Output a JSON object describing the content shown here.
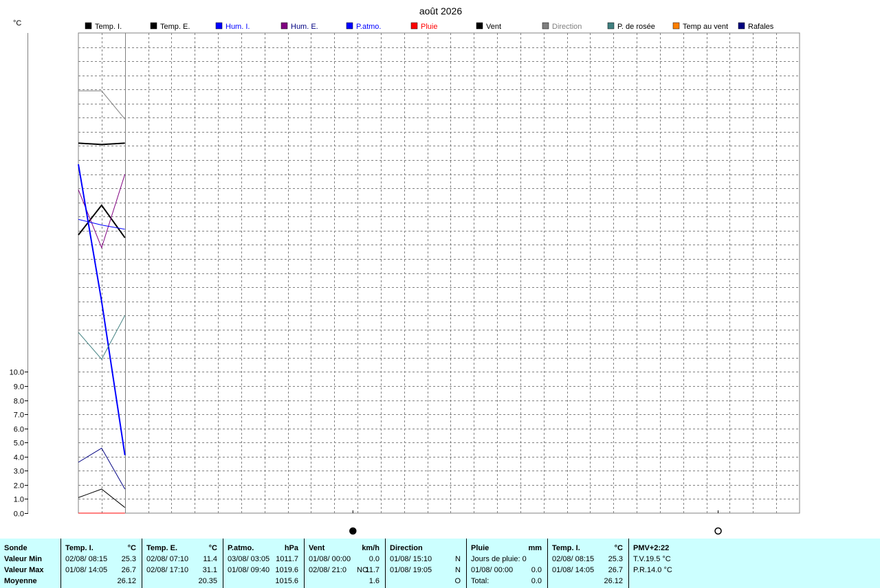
{
  "title": "août 2026",
  "y_unit": "°C",
  "colors": {
    "temp_i": "#000000",
    "temp_e": "#000000",
    "hum_i": "#0000ff",
    "hum_e": "#800080",
    "patmo": "#0000ff",
    "pluie": "#ff0000",
    "vent": "#000000",
    "direction": "#808080",
    "rosee": "#408080",
    "temp_vent": "#ff8000",
    "rafales": "#000080",
    "panel_bg": "#ccffff",
    "grid": "#808080"
  },
  "legend": [
    {
      "label": "Temp. I.",
      "color": "#000000",
      "text_color": "#000000"
    },
    {
      "label": "Temp. E.",
      "color": "#000000",
      "text_color": "#000000"
    },
    {
      "label": "Hum. I.",
      "color": "#0000ff",
      "text_color": "#0000ff"
    },
    {
      "label": "Hum. E.",
      "color": "#800080",
      "text_color": "#000080"
    },
    {
      "label": "P.atmo.",
      "color": "#0000ff",
      "text_color": "#0000ff"
    },
    {
      "label": "Pluie",
      "color": "#ff0000",
      "text_color": "#ff0000"
    },
    {
      "label": "Vent",
      "color": "#000000",
      "text_color": "#000000"
    },
    {
      "label": "Direction",
      "color": "#808080",
      "text_color": "#808080"
    },
    {
      "label": "P. de rosée",
      "color": "#408080",
      "text_color": "#000000"
    },
    {
      "label": "Temp au vent",
      "color": "#ff8000",
      "text_color": "#000000"
    },
    {
      "label": "Rafales",
      "color": "#000080",
      "text_color": "#000000"
    }
  ],
  "chart_data": {
    "type": "line",
    "title": "août 2026",
    "ylabel": "°C",
    "ylim": [
      0,
      34
    ],
    "yticks": [
      "0.0",
      "1.0",
      "2.0",
      "3.0",
      "4.0",
      "5.0",
      "6.0",
      "7.0",
      "8.0",
      "9.0",
      "10.0"
    ],
    "x_days": 31,
    "x_markers": [
      {
        "day": 12.8,
        "symbol": "full-moon-icon"
      },
      {
        "day": 28.5,
        "symbol": "new-moon-icon"
      }
    ],
    "x": [
      1,
      2,
      3
    ],
    "grid": true,
    "series": [
      {
        "name": "Temp. I.",
        "color": "#000000",
        "width": 2,
        "values": [
          26.2,
          26.1,
          26.2
        ]
      },
      {
        "name": "Temp. E.",
        "color": "#000000",
        "width": 2,
        "values": [
          19.7,
          21.8,
          19.5
        ]
      },
      {
        "name": "Hum. E.",
        "color": "#800080",
        "width": 1,
        "values": [
          22.9,
          18.8,
          24.0
        ]
      },
      {
        "name": "P.atmo.",
        "color": "#0000ff",
        "width": 2,
        "values": [
          24.7,
          15.0,
          4.1
        ]
      },
      {
        "name": "Hum. I.",
        "color": "#0000ff",
        "width": 1,
        "values": [
          20.8,
          20.4,
          20.1
        ]
      },
      {
        "name": "Direction",
        "color": "#808080",
        "width": 1,
        "values": [
          29.9,
          29.9,
          27.9
        ]
      },
      {
        "name": "P. de rosée",
        "color": "#408080",
        "width": 1,
        "values": [
          12.8,
          10.9,
          14.0
        ]
      },
      {
        "name": "Rafales",
        "color": "#000080",
        "width": 1,
        "values": [
          3.6,
          4.6,
          1.7
        ]
      },
      {
        "name": "Vent",
        "color": "#000000",
        "width": 1,
        "values": [
          1.1,
          1.7,
          0.4
        ]
      },
      {
        "name": "Pluie",
        "color": "#ff0000",
        "width": 1,
        "values": [
          0.0,
          0.0,
          0.0
        ]
      }
    ]
  },
  "stats": {
    "sonde": {
      "title": "Sonde",
      "rows": [
        "Valeur Min",
        "Valeur Max",
        "Moyenne"
      ]
    },
    "temp_i": {
      "title": "Temp. I.",
      "unit": "°C",
      "min_date": "02/08/  08:15",
      "min_val": "25.3",
      "max_date": "01/08/  14:05",
      "max_val": "26.7",
      "avg": "26.12"
    },
    "temp_e": {
      "title": "Temp. E.",
      "unit": "°C",
      "min_date": "02/08/  07:10",
      "min_val": "11.4",
      "max_date": "02/08/  17:10",
      "max_val": "31.1",
      "avg": "20.35"
    },
    "patmo": {
      "title": "P.atmo.",
      "unit": "hPa",
      "min_date": "03/08/  03:05",
      "min_val": "1011.7",
      "max_date": "01/08/  09:40",
      "max_val": "1019.6",
      "avg": "1015.6"
    },
    "vent": {
      "title": "Vent",
      "unit": "km/h",
      "min_date": "01/08/  00:00",
      "min_val": "0.0",
      "max_date": "02/08/  21:0",
      "max_dir": "NO",
      "max_val": "11.7",
      "avg": "1.6"
    },
    "direction": {
      "title": "Direction",
      "min_date": "01/08/  15:10",
      "min_val": "N",
      "max_date": "01/08/  19:05",
      "max_val": "N",
      "avg": "O"
    },
    "pluie": {
      "title": "Pluie",
      "unit": "mm",
      "days_label": "Jours de pluie: 0",
      "max_date": "01/08/  00:00",
      "max_val": "0.0",
      "total_label": "Total:",
      "total_val": "0.0"
    },
    "temp_i2": {
      "title": "Temp. I.",
      "unit": "°C",
      "min_date": "02/08/  08:15",
      "min_val": "25.3",
      "max_date": "01/08/  14:05",
      "max_val": "26.7",
      "avg": "26.12"
    },
    "pmv": {
      "title": "PMV+2:22",
      "tv": "T.V.19.5 °C",
      "pr": "P.R.14.0 °C"
    }
  }
}
